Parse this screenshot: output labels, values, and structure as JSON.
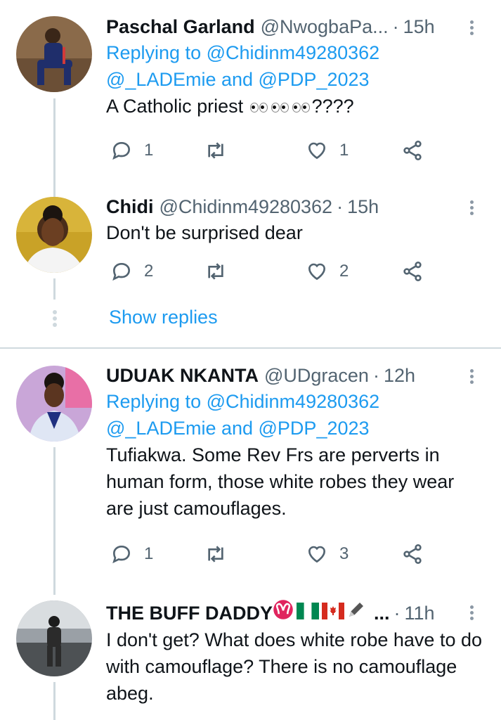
{
  "tweets": [
    {
      "name": "Paschal Garland",
      "handle": "@NwogbaPa...",
      "time": "15h",
      "reply_label": "Replying to",
      "reply_line1": "@Chidinm49280362",
      "reply_line2": "@_LADEmie and @PDP_2023",
      "text": "A Catholic priest",
      "text_suffix": "????",
      "replies": "1",
      "likes": "1"
    },
    {
      "name": "Chidi",
      "handle": "@Chidinm49280362",
      "time": "15h",
      "text": "Don't be surprised dear",
      "replies": "2",
      "likes": "2"
    },
    {
      "name": "UDUAK NKANTA",
      "handle": "@UDgracen",
      "time": "12h",
      "reply_label": "Replying to",
      "reply_line1": "@Chidinm49280362",
      "reply_line2": "@_LADEmie and @PDP_2023",
      "text": "Tufiakwa. Some Rev Frs are perverts in human form, those white robes they wear are just camouflages.",
      "replies": "1",
      "likes": "3"
    },
    {
      "name": "THE BUFF DADDY",
      "name_suffix": "...",
      "time": "11h",
      "text": "I don't get? What does white robe have to do with camouflage? There is no camouflage abeg."
    }
  ],
  "show_replies": "Show replies",
  "colors": {
    "link": "#1d9bf0",
    "muted": "#536471",
    "line": "#cfd9de"
  },
  "icons": [
    "reply-icon",
    "retweet-icon",
    "like-icon",
    "share-icon",
    "more-icon",
    "aries-icon",
    "nigeria-flag-icon",
    "canada-flag-icon",
    "pen-icon"
  ]
}
